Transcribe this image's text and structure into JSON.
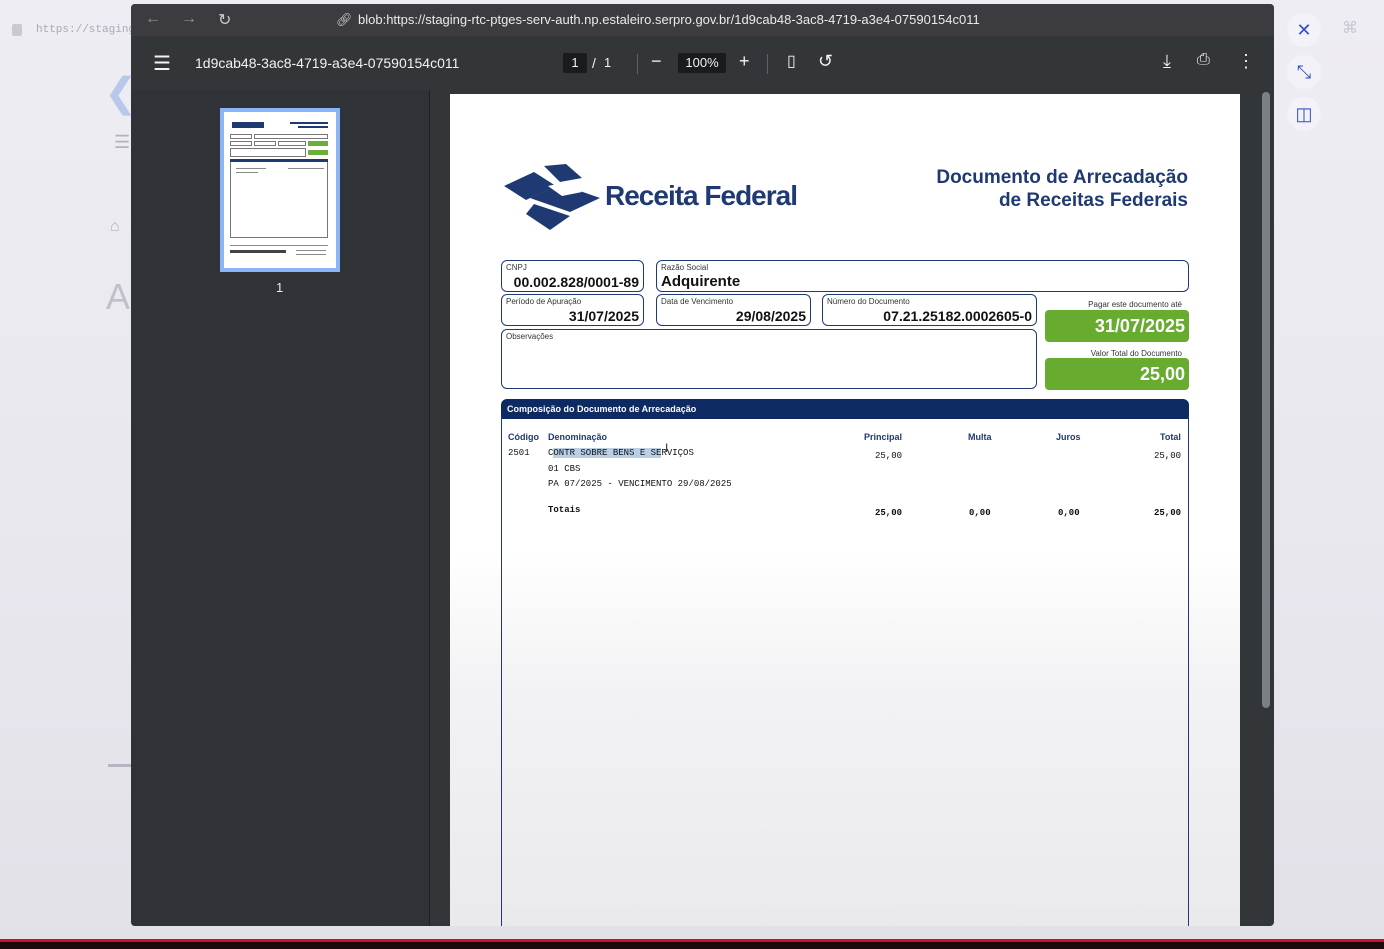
{
  "background": {
    "url_fragment": "https://staging",
    "letter": "A"
  },
  "viewer": {
    "url": "blob:https://staging-rtc-ptges-serv-auth.np.estaleiro.serpro.gov.br/1d9cab48-3ac8-4719-a3e4-07590154c011",
    "file_title": "1d9cab48-3ac8-4719-a3e4-07590154c011",
    "current_page": "1",
    "page_separator": "/",
    "total_pages": "1",
    "zoom": "100%",
    "thumbnail_label": "1"
  },
  "document": {
    "logo_text": "Receita Federal",
    "title_line1": "Documento de Arrecadação",
    "title_line2": "de Receitas Federais",
    "cnpj_label": "CNPJ",
    "cnpj": "00.002.828/0001-89",
    "razao_label": "Razão Social",
    "razao": "Adquirente",
    "periodo_label": "Período de Apuração",
    "periodo": "31/07/2025",
    "vencimento_label": "Data de Vencimento",
    "vencimento": "29/08/2025",
    "numero_label": "Número do Documento",
    "numero": "07.21.25182.0002605-0",
    "pagar_label": "Pagar este documento até",
    "pagar_ate": "31/07/2025",
    "obs_label": "Observações",
    "valor_label": "Valor Total do Documento",
    "valor_total": "25,00",
    "composicao_title": "Composição do Documento de Arrecadação",
    "columns": {
      "codigo": "Código",
      "denominacao": "Denominação",
      "principal": "Principal",
      "multa": "Multa",
      "juros": "Juros",
      "total": "Total"
    },
    "row": {
      "codigo": "2501",
      "denom_part1": "C",
      "denom_highlight": "ONTR SOBRE BENS E SE",
      "denom_part2": "RVIÇOS",
      "denom_line2": "01 CBS",
      "denom_line3": "PA 07/2025 - VENCIMENTO 29/08/2025",
      "principal": "25,00",
      "total": "25,00"
    },
    "totais": {
      "label": "Totais",
      "principal": "25,00",
      "multa": "0,00",
      "juros": "0,00",
      "total": "25,00"
    }
  },
  "colors": {
    "brand_blue": "#1f3a73",
    "green": "#67ab2f",
    "viewer_dark": "#323639"
  }
}
